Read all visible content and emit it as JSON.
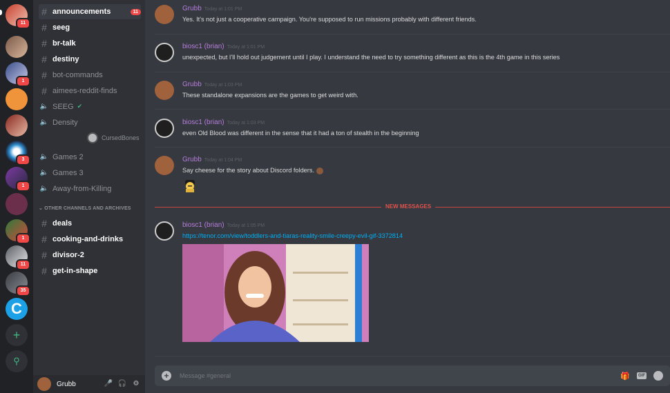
{
  "channels": {
    "items": [
      {
        "kind": "text",
        "label": "announcements",
        "unread": true,
        "badge": "11"
      },
      {
        "kind": "text",
        "label": "seeg",
        "unread": true
      },
      {
        "kind": "text",
        "label": "br-talk",
        "unread": true
      },
      {
        "kind": "text",
        "label": "destiny",
        "unread": true
      },
      {
        "kind": "text",
        "label": "bot-commands",
        "unread": false
      },
      {
        "kind": "text",
        "label": "aimees-reddit-finds",
        "unread": false
      },
      {
        "kind": "voice",
        "label": "SEEG",
        "unread": false
      },
      {
        "kind": "voice",
        "label": "Density",
        "unread": false
      },
      {
        "kind": "voice",
        "label": "Games 2",
        "unread": false
      },
      {
        "kind": "voice",
        "label": "Games 3",
        "unread": false
      },
      {
        "kind": "voice",
        "label": "Away-from-Killing",
        "unread": false
      }
    ],
    "voice_user": "CursedBones",
    "category": "OTHER CHANNELS AND ARCHIVES",
    "archive_items": [
      {
        "label": "deals"
      },
      {
        "label": "cooking-and-drinks"
      },
      {
        "label": "divisor-2"
      },
      {
        "label": "get-in-shape"
      }
    ]
  },
  "servers": {
    "badges": [
      "11",
      "1",
      "3",
      "1",
      "1",
      "11",
      "35"
    ]
  },
  "user": {
    "name": "Grubb"
  },
  "messages": [
    {
      "author": "Grubb",
      "time": "Today at 1:01 PM",
      "text": "Yes. It's not just a cooperative campaign. You're supposed to run missions probably with different friends."
    },
    {
      "author": "biosc1 (brian)",
      "time": "Today at 1:01 PM",
      "text": "unexpected, but I'll hold out judgement until I play.  I understand the need to try something different as this is the 4th game in this series"
    },
    {
      "author": "Grubb",
      "time": "Today at 1:03 PM",
      "text": "These standalone expansions are the games to get weird with."
    },
    {
      "author": "biosc1 (brian)",
      "time": "Today at 1:03 PM",
      "text": "even Old Blood was different in the sense that it had a ton of stealth in the beginning"
    },
    {
      "author": "Grubb",
      "time": "Today at 1:04 PM",
      "text": "Say cheese for the story about Discord folders."
    },
    {
      "author": "biosc1 (brian)",
      "time": "Today at 1:05 PM",
      "link": "https://tenor.com/view/toddlers-and-tiaras-reality-smile-creepy-evil-gif-3372814"
    }
  ],
  "new_messages_label": "NEW MESSAGES",
  "composer": {
    "placeholder": "Message #general",
    "gif_label": "GIF"
  },
  "colors": {
    "accent_author": "#b57edc",
    "new_messages": "#e0524c",
    "link": "#00b0f4",
    "badge": "#f04747"
  }
}
